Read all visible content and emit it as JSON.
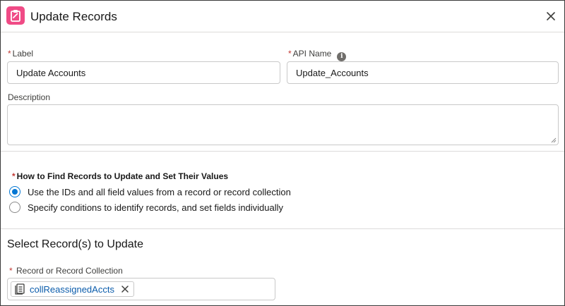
{
  "header": {
    "title": "Update Records",
    "icon": "clipboard-icon",
    "icon_color": "#f04b86",
    "close_icon": "close-icon"
  },
  "form": {
    "required_marker": "*",
    "label": {
      "label": "Label",
      "value": "Update Accounts"
    },
    "api_name": {
      "label": "API Name",
      "value": "Update_Accounts",
      "info_glyph": "i"
    },
    "description": {
      "label": "Description",
      "value": ""
    }
  },
  "find_records": {
    "question": "How to Find Records to Update and Set Their Values",
    "options": [
      {
        "label": "Use the IDs and all field values from a record or record collection",
        "selected": true
      },
      {
        "label": "Specify conditions to identify records, and set fields individually",
        "selected": false
      }
    ]
  },
  "select_records": {
    "heading": "Select Record(s) to Update",
    "field_label": "Record or Record Collection",
    "pill_value": "collReassignedAccts",
    "pill_icon": "record-collection-icon"
  },
  "colors": {
    "accent": "#0176d3",
    "required": "#c23934",
    "pill_text": "#0b5cab"
  }
}
